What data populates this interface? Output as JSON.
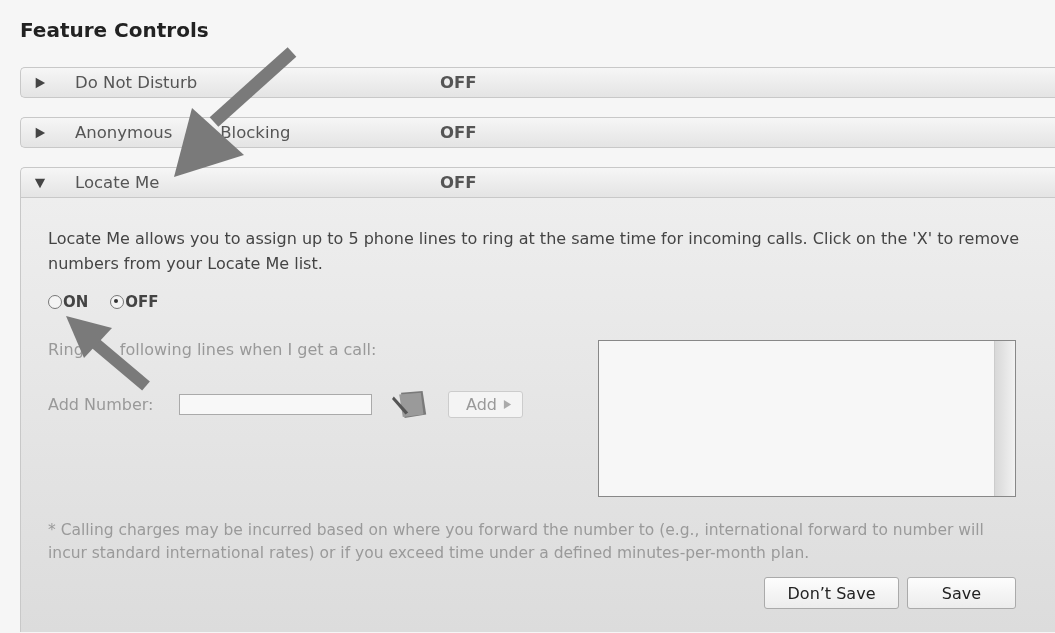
{
  "title": "Feature Controls",
  "features": [
    {
      "label_parts": [
        "Do Not Disturb"
      ],
      "status": "OFF",
      "expanded": false
    },
    {
      "label_parts": [
        "Anonymous",
        "Blocking"
      ],
      "status": "OFF",
      "expanded": false
    },
    {
      "label_parts": [
        "Locate Me"
      ],
      "status": "OFF",
      "expanded": true
    }
  ],
  "panel": {
    "description": "Locate Me allows you to assign up to 5 phone lines to ring at the same time for incoming calls. Click on the 'X' to remove numbers from your Locate Me list.",
    "options": [
      {
        "label": "ON",
        "selected": false
      },
      {
        "label": "OFF",
        "selected": true
      }
    ],
    "ring_label_parts": [
      "Ring",
      "following lines when I get a call:"
    ],
    "add_number_label": "Add Number:",
    "add_button": "Add",
    "footnote": "* Calling charges may be incurred based on where you forward the number to (e.g., international forward to number will incur standard international rates) or if you exceed time under a defined minutes-per-month plan.",
    "buttons": [
      "Don’t Save",
      "Save"
    ]
  }
}
